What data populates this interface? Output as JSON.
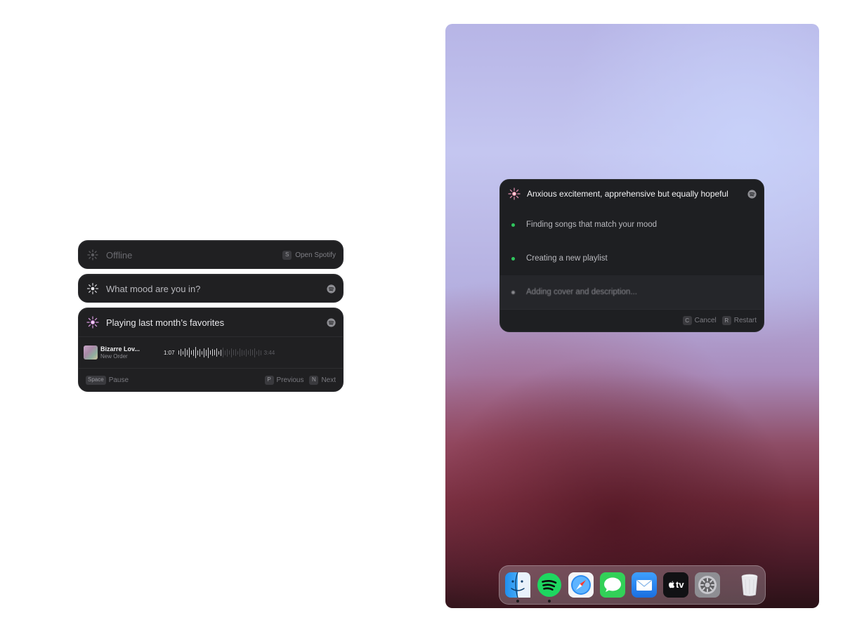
{
  "panels": {
    "offline": {
      "label": "Offline",
      "hint_key": "S",
      "hint_label": "Open Spotify"
    },
    "mood": {
      "label": "What mood are you in?"
    },
    "playing": {
      "label": "Playing last month’s favorites",
      "track_title": "Bizarre Lov...",
      "track_artist": "New Order",
      "elapsed": "1:07",
      "duration": "3:44",
      "progress": 0.3,
      "footer": {
        "pause_key": "Space",
        "pause_label": "Pause",
        "prev_key": "P",
        "prev_label": "Previous",
        "next_key": "N",
        "next_label": "Next"
      }
    }
  },
  "desktop": {
    "panel": {
      "title": "Anxious excitement, apprehensive but equally hopeful",
      "steps": [
        {
          "label": "Finding songs that match your mood",
          "status": "done"
        },
        {
          "label": "Creating a new playlist",
          "status": "done"
        },
        {
          "label": "Adding cover and description...",
          "status": "in-progress"
        }
      ],
      "footer": {
        "cancel_key": "C",
        "cancel_label": "Cancel",
        "restart_key": "R",
        "restart_label": "Restart"
      }
    },
    "dock": {
      "apps": [
        {
          "name": "Finder",
          "icon": "finder-icon",
          "running": true
        },
        {
          "name": "Spotify",
          "icon": "spotify-icon",
          "running": true
        },
        {
          "name": "Safari",
          "icon": "safari-icon",
          "running": false
        },
        {
          "name": "Messages",
          "icon": "messages-icon",
          "running": false
        },
        {
          "name": "Mail",
          "icon": "mail-icon",
          "running": false
        },
        {
          "name": "TV",
          "icon": "appletv-icon",
          "running": false,
          "text": "tv"
        },
        {
          "name": "System Settings",
          "icon": "settings-icon",
          "running": false
        },
        {
          "name": "Trash",
          "icon": "trash-icon",
          "running": false
        }
      ]
    }
  },
  "colors": {
    "panel_bg": "#202022",
    "done_dot": "#2fc65d",
    "spotify_green": "#1ed760"
  }
}
